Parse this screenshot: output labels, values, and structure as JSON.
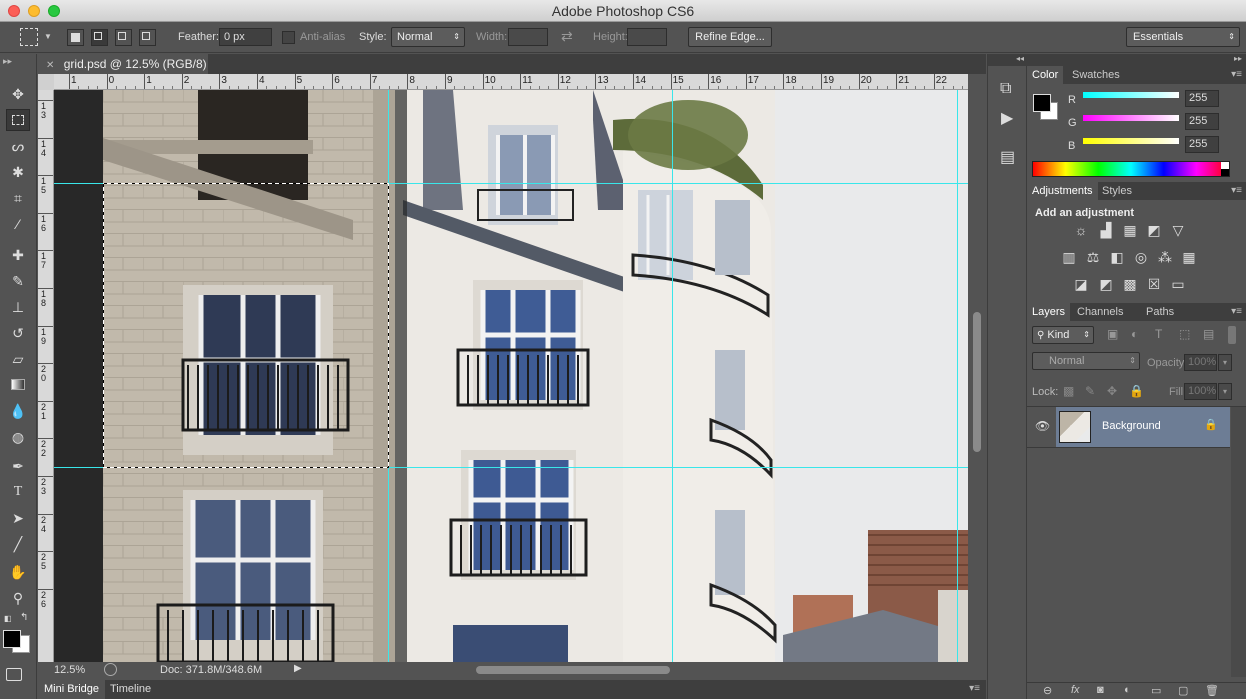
{
  "app": {
    "title": "Adobe Photoshop CS6"
  },
  "options": {
    "feather_label": "Feather:",
    "feather_value": "0 px",
    "antialias_label": "Anti-alias",
    "style_label": "Style:",
    "style_value": "Normal",
    "width_label": "Width:",
    "height_label": "Height:",
    "refine_edge": "Refine Edge...",
    "workspace": "Essentials"
  },
  "document": {
    "tab_title": "grid.psd @ 12.5% (RGB/8) *",
    "zoom": "12.5%",
    "doc_size": "Doc: 371.8M/348.6M",
    "ruler_top": [
      "1",
      "0",
      "1",
      "2",
      "3",
      "4",
      "5",
      "6",
      "7",
      "8",
      "9",
      "10",
      "11",
      "12",
      "13",
      "14",
      "15",
      "16",
      "17",
      "18",
      "19",
      "20",
      "21",
      "22"
    ],
    "ruler_left": [
      "1\n3",
      "1\n4",
      "1\n5",
      "1\n6",
      "1\n7",
      "1\n8",
      "1\n9",
      "2\n0",
      "2\n1",
      "2\n2",
      "2\n3",
      "2\n4",
      "2\n5",
      "2\n6"
    ]
  },
  "bottom_tabs": {
    "mini_bridge": "Mini Bridge",
    "timeline": "Timeline"
  },
  "color_panel": {
    "tabs": [
      "Color",
      "Swatches"
    ],
    "r_label": "R",
    "g_label": "G",
    "b_label": "B",
    "r": "255",
    "g": "255",
    "b": "255"
  },
  "adjustments_panel": {
    "tabs": [
      "Adjustments",
      "Styles"
    ],
    "heading": "Add an adjustment"
  },
  "layers_panel": {
    "tabs": [
      "Layers",
      "Channels",
      "Paths"
    ],
    "filter": "Kind",
    "blend_mode": "Normal",
    "opacity_label": "Opacity:",
    "opacity_value": "100%",
    "lock_label": "Lock:",
    "fill_label": "Fill:",
    "fill_value": "100%",
    "layers": [
      {
        "name": "Background"
      }
    ]
  },
  "colors": {
    "guide": "#39e6ea",
    "panel_bg": "#535353",
    "layer_selected": "#6d7d95"
  }
}
